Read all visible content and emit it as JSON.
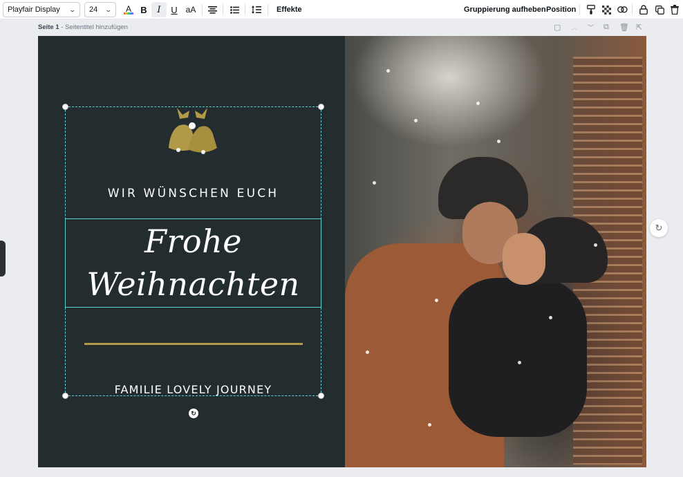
{
  "toolbar": {
    "font_family": "Playfair Display",
    "font_size": "24",
    "text_color_glyph": "A",
    "bold": "B",
    "italic": "I",
    "underline": "U",
    "case": "aA",
    "effects_label": "Effekte",
    "ungroup_label": "Gruppierung aufheben",
    "position_label": "Position"
  },
  "page": {
    "number_label": "Seite 1",
    "title_placeholder": "- Seitentitel hinzufügen"
  },
  "design": {
    "line1": "WIR WÜNSCHEN EUCH",
    "title_line1": "Frohe",
    "title_line2": "Weihnachten",
    "family": "FAMILIE LOVELY JOURNEY"
  },
  "colors": {
    "background": "#232d2f",
    "selection": "#5fd3d9",
    "gold": "#b19a4a"
  },
  "icons": {
    "text_color": "text-color-icon",
    "align": "align-center-icon",
    "list": "bullet-list-icon",
    "spacing": "line-spacing-icon",
    "paint": "paint-format-icon",
    "transparency": "transparency-icon",
    "link": "link-icon",
    "lock": "lock-icon",
    "duplicate": "duplicate-icon",
    "trash": "trash-icon",
    "rotate": "rotate-icon",
    "refresh": "refresh-icon"
  }
}
